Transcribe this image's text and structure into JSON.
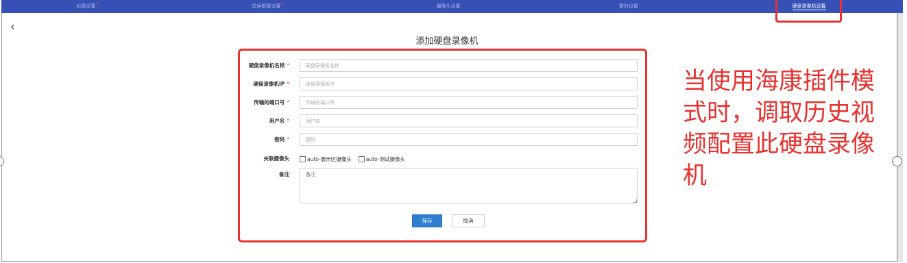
{
  "tabs": [
    {
      "label": "标题设置",
      "required": true
    },
    {
      "label": "拉闸报警设置",
      "required": true
    },
    {
      "label": "摄像头设置",
      "required": false
    },
    {
      "label": "警铃设置",
      "required": false
    },
    {
      "label": "硬盘录像机设置",
      "required": false,
      "active": true
    }
  ],
  "nav": {
    "back": "‹"
  },
  "form": {
    "title": "添加硬盘录像机",
    "required_mark": "*",
    "fields": {
      "name": {
        "label": "硬盘录像机名称",
        "placeholder": "硬盘录像机名称"
      },
      "ip": {
        "label": "硬盘录像机IP",
        "placeholder": "硬盘录像机IP"
      },
      "port": {
        "label": "传输的端口号",
        "placeholder": "传输的端口号"
      },
      "username": {
        "label": "用户名",
        "placeholder": "用户名"
      },
      "password": {
        "label": "密码",
        "placeholder": "密码"
      }
    },
    "cameras": {
      "label": "关联摄像头",
      "options": [
        "auto-展示区摄像头",
        "auto-测试摄像头"
      ]
    },
    "notes": {
      "label": "备注",
      "placeholder": "备注"
    },
    "save_label": "保存",
    "cancel_label": "取消"
  },
  "annotation": "当使用海康插件模式时，调取历史视频配置此硬盘录像机",
  "colors": {
    "tabbar": "#3650b5",
    "highlight": "#e8322f",
    "primary_button": "#2f7fd0"
  }
}
